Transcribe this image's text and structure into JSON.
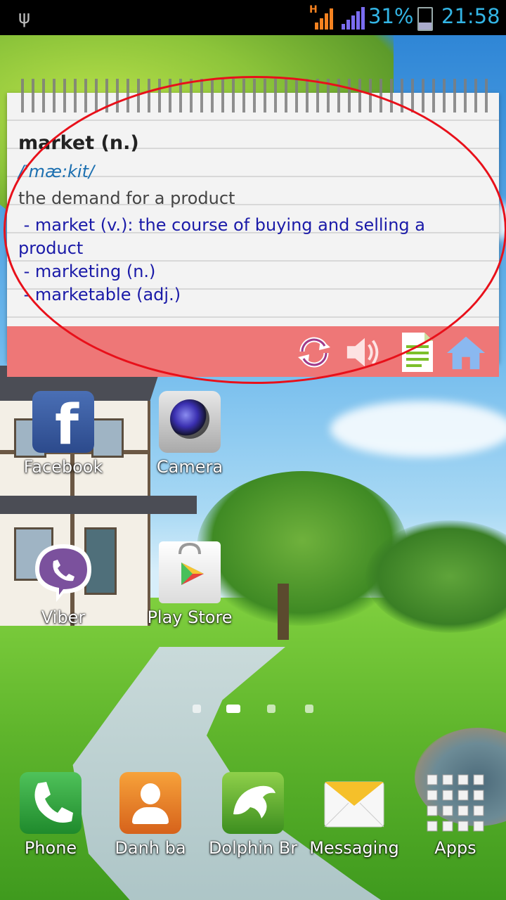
{
  "status_bar": {
    "network": "H",
    "battery_percent": "31%",
    "time": "21:58"
  },
  "dictionary": {
    "word": "market (n.)",
    "phonetic": "/'mæ:kit/",
    "meaning": "the demand for a product",
    "related": [
      " - market (v.): the course of buying and selling a product",
      " - marketing (n.)",
      " - marketable (adj.)"
    ],
    "toolbar": [
      "refresh-icon",
      "speaker-icon",
      "document-icon",
      "home-icon"
    ]
  },
  "home_apps": [
    {
      "label": "Facebook"
    },
    {
      "label": "Camera"
    },
    {
      "label": "Viber"
    },
    {
      "label": "Play Store"
    }
  ],
  "dock": [
    {
      "label": "Phone"
    },
    {
      "label": "Danh ba"
    },
    {
      "label": "Dolphin Br"
    },
    {
      "label": "Messaging"
    },
    {
      "label": "Apps"
    }
  ],
  "colors": {
    "status_blue": "#33b5e5",
    "toolbar": "#ee7777",
    "highlight_circle": "#e8101a"
  }
}
